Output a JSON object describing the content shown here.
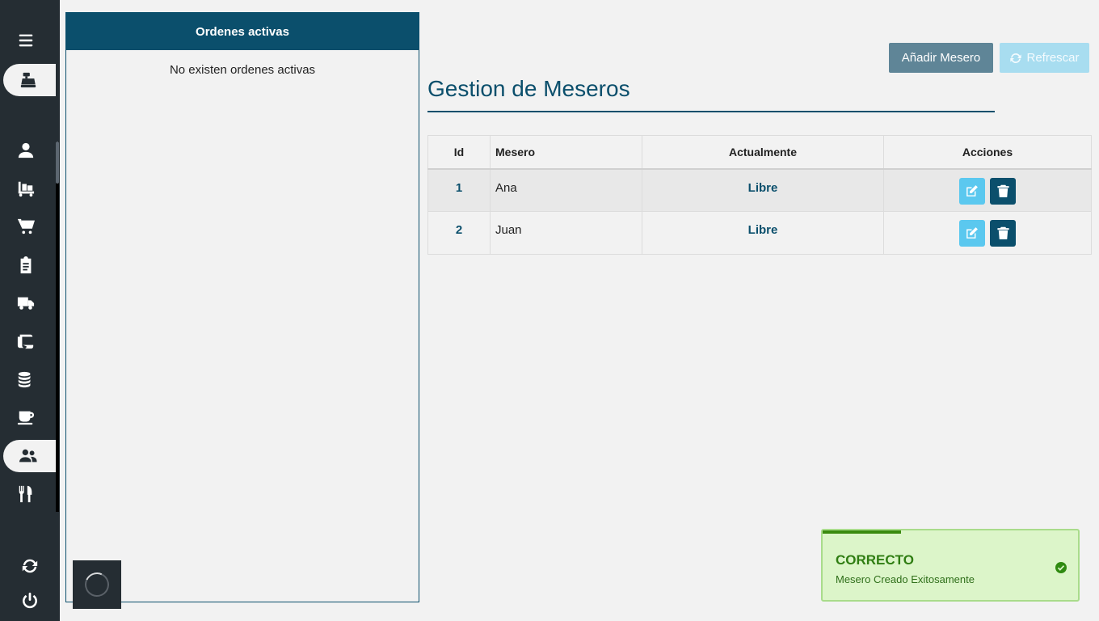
{
  "sidebar": {
    "items": [
      {
        "icon": "menu-icon"
      },
      {
        "icon": "cash-register-icon",
        "active": true
      },
      {
        "icon": "user-icon"
      },
      {
        "icon": "dolly-icon"
      },
      {
        "icon": "cart-icon"
      },
      {
        "icon": "clipboard-icon"
      },
      {
        "icon": "truck-icon"
      },
      {
        "icon": "scroll-icon"
      },
      {
        "icon": "coins-icon"
      },
      {
        "icon": "coffee-icon"
      },
      {
        "icon": "users-icon",
        "active": true
      },
      {
        "icon": "utensils-icon"
      },
      {
        "icon": "sync-icon"
      },
      {
        "icon": "power-icon"
      }
    ]
  },
  "orders": {
    "title": "Ordenes activas",
    "empty_text": "No existen ordenes activas"
  },
  "toolbar": {
    "add_label": "Añadir Mesero",
    "refresh_label": "Refrescar"
  },
  "page": {
    "title": "Gestion de Meseros"
  },
  "table": {
    "headers": [
      "Id",
      "Mesero",
      "Actualmente",
      "Acciones"
    ],
    "rows": [
      {
        "id": "1",
        "name": "Ana",
        "state": "Libre"
      },
      {
        "id": "2",
        "name": "Juan",
        "state": "Libre"
      }
    ]
  },
  "toast": {
    "title": "CORRECTO",
    "message": "Mesero Creado Exitosamente"
  },
  "colors": {
    "primary": "#0b4f6c",
    "sidebar": "#252d33",
    "accent": "#5bc8ef",
    "success": "#2f7d12"
  }
}
